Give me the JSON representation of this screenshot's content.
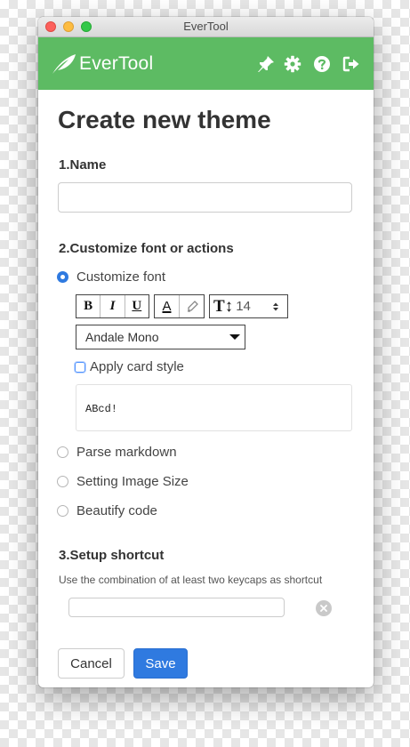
{
  "window": {
    "title": "EverTool"
  },
  "appbar": {
    "app_name": "EverTool",
    "icons": [
      "feather-logo-icon",
      "pin-icon",
      "gear-icon",
      "help-icon",
      "sign-out-icon"
    ],
    "color": "#5dbb63"
  },
  "page": {
    "title": "Create new theme"
  },
  "section1": {
    "title": "1.Name",
    "name_value": "",
    "name_placeholder": ""
  },
  "section2": {
    "title": "2.Customize font or actions",
    "options": [
      {
        "label": "Customize font",
        "selected": true
      },
      {
        "label": "Parse markdown",
        "selected": false
      },
      {
        "label": "Setting Image Size",
        "selected": false
      },
      {
        "label": "Beautify code",
        "selected": false
      }
    ],
    "toolbar": {
      "bold": "B",
      "italic": "I",
      "underline": "U",
      "font_color": "A",
      "font_size": "14"
    },
    "font_family": "Andale Mono",
    "apply_card_style": "Apply card style",
    "preview_text": "ABcd!"
  },
  "section3": {
    "title": "3.Setup shortcut",
    "hint": "Use the combination of at least two keycaps as shortcut",
    "shortcut_value": ""
  },
  "actions": {
    "cancel": "Cancel",
    "save": "Save"
  },
  "colors": {
    "accent": "#2f7ae0",
    "brand_green": "#5dbb63"
  }
}
